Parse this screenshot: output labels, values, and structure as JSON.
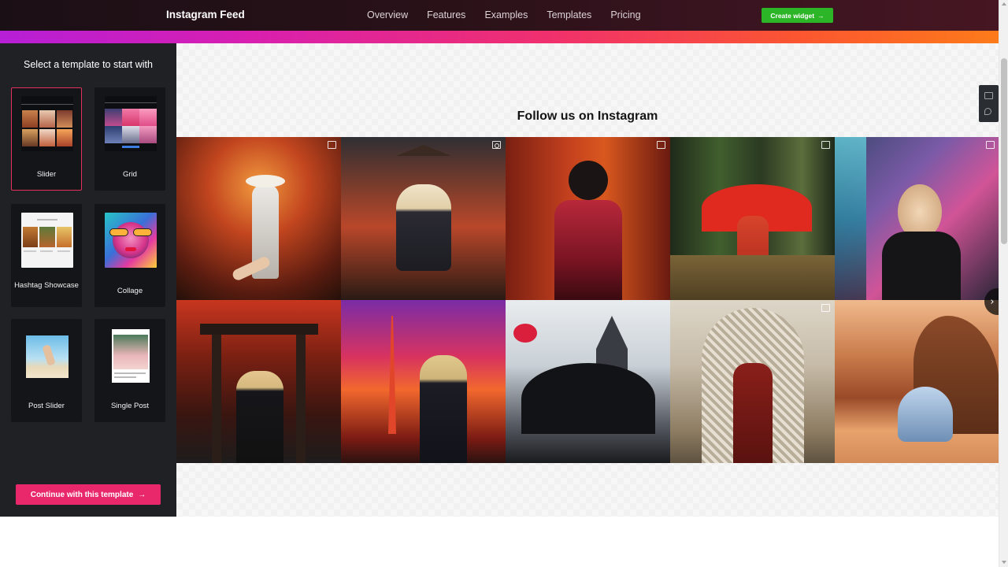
{
  "header": {
    "brand": "Instagram Feed",
    "nav": [
      "Overview",
      "Features",
      "Examples",
      "Templates",
      "Pricing"
    ],
    "cta_label": "Create widget",
    "cta_color": "#2db528"
  },
  "sidebar": {
    "title": "Select a template to start with",
    "selected_template": "Slider",
    "templates": [
      {
        "label": "Slider"
      },
      {
        "label": "Grid"
      },
      {
        "label": "Hashtag Showcase"
      },
      {
        "label": "Collage"
      },
      {
        "label": "Post Slider"
      },
      {
        "label": "Single Post"
      }
    ],
    "continue_label": "Continue with this template",
    "accent_color": "#e8286a"
  },
  "preview": {
    "feed_title": "Follow us on Instagram",
    "posts": [
      {
        "badge": "gallery",
        "scene": "autumn-forest-hat"
      },
      {
        "badge": "video",
        "scene": "pagoda-red-leaves"
      },
      {
        "badge": "gallery",
        "scene": "red-torii-corridor"
      },
      {
        "badge": "gallery",
        "scene": "bamboo-red-umbrella"
      },
      {
        "badge": "gallery",
        "scene": "neon-city-street"
      },
      {
        "badge": "none",
        "scene": "torii-gate-autumn"
      },
      {
        "badge": "none",
        "scene": "tokyo-tower-sunset"
      },
      {
        "badge": "none",
        "scene": "castle-dark-wings"
      },
      {
        "badge": "gallery",
        "scene": "ornate-doorway"
      },
      {
        "badge": "none",
        "scene": "desert-rock-arch"
      }
    ]
  }
}
